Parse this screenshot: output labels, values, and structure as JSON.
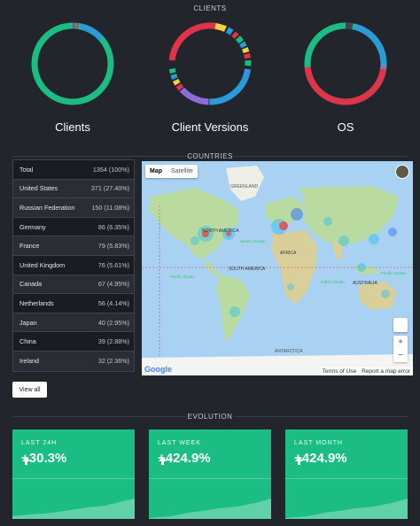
{
  "sections": {
    "clients": "CLIENTS",
    "countries": "COUNTRIES",
    "evolution": "EVOLUTION"
  },
  "donuts": [
    {
      "label": "Clients",
      "colors": {
        "main": "#1cbd85",
        "accent1": "#2a9bd8",
        "accent2": "#e0344a",
        "accent3": "#6b5b95"
      }
    },
    {
      "label": "Client Versions",
      "colors": {
        "red": "#e0344a",
        "yellow": "#f4d03f",
        "green": "#1cbd85",
        "blue": "#2a9bd8",
        "purple": "#8e6bd8"
      }
    },
    {
      "label": "OS",
      "colors": {
        "green": "#1cbd85",
        "blue": "#2a9bd8",
        "red": "#e0344a",
        "purple": "#8e6bd8"
      }
    }
  ],
  "countries": [
    {
      "name": "Total",
      "value": "1354 (100%)"
    },
    {
      "name": "United States",
      "value": "371 (27.40%)"
    },
    {
      "name": "Russian Federation",
      "value": "150 (11.08%)"
    },
    {
      "name": "Germany",
      "value": "86 (6.35%)"
    },
    {
      "name": "France",
      "value": "79 (5.83%)"
    },
    {
      "name": "United Kingdom",
      "value": "76 (5.61%)"
    },
    {
      "name": "Canada",
      "value": "67 (4.95%)"
    },
    {
      "name": "Netherlands",
      "value": "56 (4.14%)"
    },
    {
      "name": "Japan",
      "value": "40 (2.95%)"
    },
    {
      "name": "China",
      "value": "39 (2.88%)"
    },
    {
      "name": "Ireland",
      "value": "32 (2.36%)"
    }
  ],
  "view_all": "View all",
  "map": {
    "tab_map": "Map",
    "tab_satellite": "Satellite",
    "labels": [
      "GREENLAND",
      "NORTH AMERICA",
      "Atlantic Ocean",
      "AFRICA",
      "SOUTH AMERICA",
      "Pacific Ocean",
      "Indian Ocean",
      "AUSTRALIA",
      "ANTARCTICA",
      "Pacific Ocean"
    ],
    "google": "Google",
    "terms": "Terms of Use",
    "report": "Report a map error",
    "zoom_in": "+",
    "zoom_out": "−"
  },
  "evolution": [
    {
      "caption": "LAST 24H",
      "value": "+30.3%"
    },
    {
      "caption": "LAST WEEK",
      "value": "+424.9%"
    },
    {
      "caption": "LAST MONTH",
      "value": "+424.9%"
    }
  ]
}
